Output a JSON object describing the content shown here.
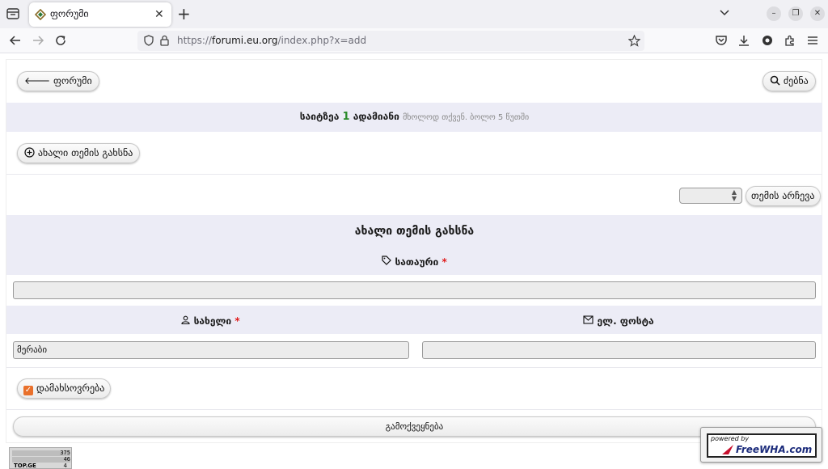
{
  "browser": {
    "tab_title": "ფორუმი",
    "url_prefix": "https://",
    "url_host": "forumi.eu.org",
    "url_path": "/index.php?x=add"
  },
  "page": {
    "back_button": "ფორუმი",
    "search_button": "ძებნა",
    "online": {
      "prefix": "საიტზეა",
      "count": "1",
      "unit": "ადამიანი",
      "suffix": "მხოლოდ თქვენ. ბოლო 5 წუთში"
    },
    "new_topic_button": "ახალი თემის გახსნა",
    "choose_topic_button": "თემის არჩევა",
    "form": {
      "title": "ახალი თემის გახსნა",
      "subject_label": "სათაური",
      "subject_value": "",
      "name_label": "სახელი",
      "name_value": "მერაბი",
      "email_label": "ელ. ფოსტა",
      "email_value": "",
      "required_mark": "*",
      "remember_label": "დამახსოვრება",
      "remember_checked": true,
      "submit_label": "გამოქვეყნება"
    }
  },
  "badges": {
    "counter": {
      "line1": "375",
      "line2": "46",
      "brand": "TOP.GE",
      "line3": "4"
    },
    "powered_by": "powered by",
    "powered_logo": "FreeWHA.com"
  },
  "colors": {
    "band": "#ececf6",
    "online_count": "#2a8a2a",
    "required": "#e01b1b",
    "checkbox": "#e9702b"
  }
}
